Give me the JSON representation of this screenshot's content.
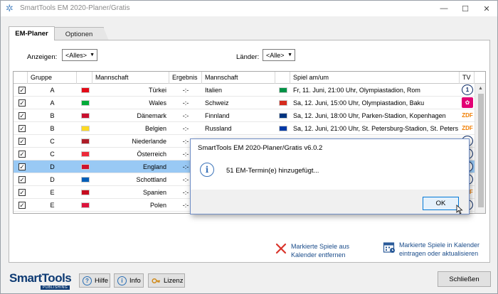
{
  "window": {
    "title": "SmartTools EM 2020-Planer/Gratis"
  },
  "tabs": [
    {
      "label": "EM-Planer",
      "active": true
    },
    {
      "label": "Optionen",
      "active": false
    }
  ],
  "filters": {
    "anzeigen_label": "Anzeigen:",
    "anzeigen_value": "<Alles>",
    "laender_label": "Länder:",
    "laender_value": "<Alle>"
  },
  "table": {
    "columns": [
      "",
      "Gruppe",
      "",
      "Mannschaft",
      "Ergebnis",
      "Mannschaft",
      "",
      "Spiel am/um",
      "TV"
    ],
    "rows": [
      {
        "checked": true,
        "gruppe": "A",
        "team1": "Türkei",
        "ergebnis": "-:-",
        "team2": "Italien",
        "spiel": "Fr, 11. Juni, 21:00 Uhr, Olympiastadion, Rom",
        "tv": "ARD",
        "flag1": "#e30a17",
        "flag2": "#009246"
      },
      {
        "checked": true,
        "gruppe": "A",
        "team1": "Wales",
        "ergebnis": "-:-",
        "team2": "Schweiz",
        "spiel": "Sa, 12. Juni, 15:00 Uhr, Olympiastadion, Baku",
        "tv": "Magenta",
        "flag1": "#00ab39",
        "flag2": "#d52b1e"
      },
      {
        "checked": true,
        "gruppe": "B",
        "team1": "Dänemark",
        "ergebnis": "-:-",
        "team2": "Finnland",
        "spiel": "Sa, 12. Juni, 18:00 Uhr, Parken-Stadion, Kopenhagen",
        "tv": "ZDF",
        "flag1": "#c8102e",
        "flag2": "#003580"
      },
      {
        "checked": true,
        "gruppe": "B",
        "team1": "Belgien",
        "ergebnis": "-:-",
        "team2": "Russland",
        "spiel": "Sa, 12. Juni, 21:00 Uhr, St. Petersburg-Stadion, St. Petersburg",
        "tv": "ZDF",
        "flag1": "#fdda24",
        "flag2": "#0039a6"
      },
      {
        "checked": true,
        "gruppe": "C",
        "team1": "Niederlande",
        "ergebnis": "-:-",
        "team2": "",
        "spiel": "",
        "tv": "ARD",
        "flag1": "#ae1c28",
        "flag2": ""
      },
      {
        "checked": true,
        "gruppe": "C",
        "team1": "Österreich",
        "ergebnis": "-:-",
        "team2": "",
        "spiel": "",
        "tv": "ARD",
        "flag1": "#ed2939",
        "flag2": ""
      },
      {
        "checked": true,
        "gruppe": "D",
        "team1": "England",
        "ergebnis": "-:-",
        "team2": "",
        "spiel": "",
        "tv": "ARD",
        "flag1": "#cf142b",
        "flag2": "",
        "selected": true
      },
      {
        "checked": true,
        "gruppe": "D",
        "team1": "Schottland",
        "ergebnis": "-:-",
        "team2": "",
        "spiel": "",
        "tv": "ARD",
        "flag1": "#005eb8",
        "flag2": ""
      },
      {
        "checked": true,
        "gruppe": "E",
        "team1": "Spanien",
        "ergebnis": "-:-",
        "team2": "",
        "spiel": "",
        "tv": "ZDF",
        "flag1": "#c60b1e",
        "flag2": ""
      },
      {
        "checked": true,
        "gruppe": "E",
        "team1": "Polen",
        "ergebnis": "-:-",
        "team2": "",
        "spiel": "",
        "tv": "ARD",
        "flag1": "#dc143c",
        "flag2": ""
      }
    ]
  },
  "actions": {
    "remove_line1": "Markierte Spiele aus",
    "remove_line2": "Kalender entfernen",
    "add_line1": "Markierte Spiele in Kalender",
    "add_line2": "eintragen oder aktualisieren"
  },
  "footer": {
    "logo_text": "SmartTools",
    "logo_sub": "PUBLISHING",
    "hilfe": "Hilfe",
    "info": "Info",
    "lizenz": "Lizenz",
    "schliessen": "Schließen"
  },
  "dialog": {
    "title": "SmartTools EM 2020-Planer/Gratis v6.0.2",
    "message": "51 EM-Termin(e) hinzugefügt...",
    "ok": "OK"
  }
}
